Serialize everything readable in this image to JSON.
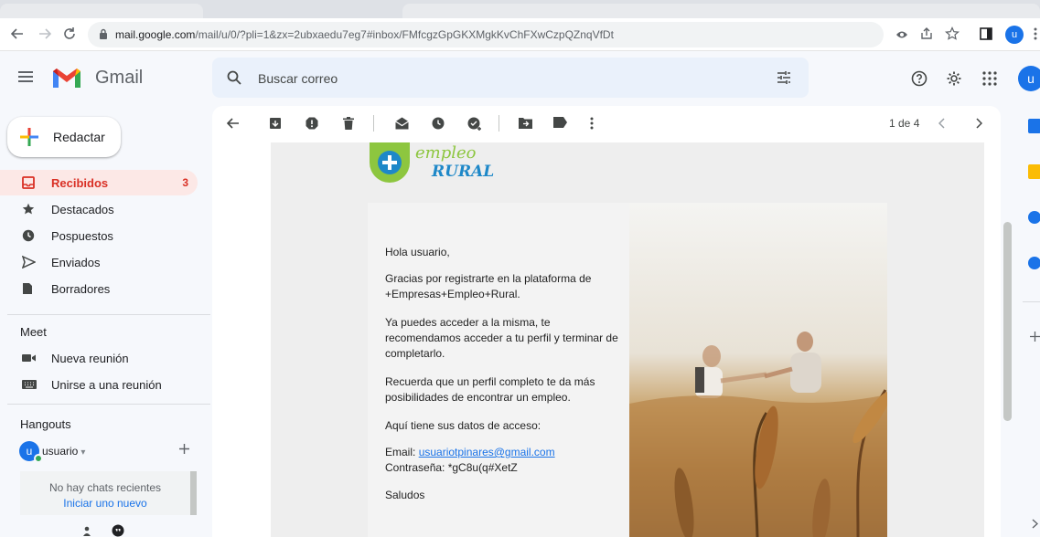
{
  "browser": {
    "url_host": "mail.google.com",
    "url_path": "/mail/u/0/?pli=1&zx=2ubxaedu7eg7#inbox/FMfcgzGpGKXMgkKvChFXwCzpQZnqVfDt",
    "profile_initial": "u"
  },
  "header": {
    "app_name": "Gmail",
    "search_placeholder": "Buscar correo",
    "account_initial": "u"
  },
  "sidebar": {
    "compose_label": "Redactar",
    "items": [
      {
        "label": "Recibidos",
        "count": "3",
        "icon": "inbox-icon"
      },
      {
        "label": "Destacados",
        "icon": "star-icon"
      },
      {
        "label": "Pospuestos",
        "icon": "clock-icon"
      },
      {
        "label": "Enviados",
        "icon": "send-icon"
      },
      {
        "label": "Borradores",
        "icon": "draft-icon"
      }
    ],
    "meet": {
      "title": "Meet",
      "new_meeting": "Nueva reunión",
      "join_meeting": "Unirse a una reunión"
    },
    "hangouts": {
      "title": "Hangouts",
      "user_initial": "u",
      "user_name": "usuario",
      "no_chats": "No hay chats recientes",
      "start_new": "Iniciar uno nuevo"
    }
  },
  "toolbar": {
    "pager": "1 de 4"
  },
  "email": {
    "logo_line1": "empleo",
    "logo_line2": "RURAL",
    "greeting": "Hola usuario,",
    "para1": "Gracias por registrarte en la plataforma de +Empresas+Empleo+Rural.",
    "para2": "Ya puedes acceder a la misma, te recomendamos acceder a tu perfil y terminar de completarlo.",
    "para3": "Recuerda que un perfil completo te da más posibilidades de encontrar un empleo.",
    "para4": "Aquí tiene sus datos de acceso:",
    "email_label": "Email: ",
    "email_value": "usuariotpinares@gmail.com",
    "password_line": "Contraseña: *gC8u(q#XetZ",
    "closing": "Saludos"
  },
  "colors": {
    "accent_blue": "#1a73e8",
    "active_red": "#d93025",
    "logo_green": "#8dc63f",
    "logo_blue": "#1e88c8"
  }
}
